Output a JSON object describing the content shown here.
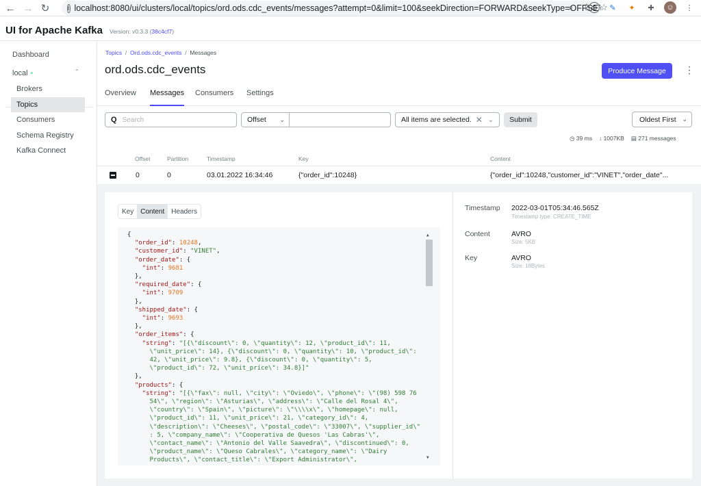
{
  "browser": {
    "url": "localhost:8080/ui/clusters/local/topics/ord.ods.cdc_events/messages?attempt=0&limit=100&seekDirection=FORWARD&seekType=OFFSET..."
  },
  "app": {
    "title": "UI for Apache Kafka",
    "version_prefix": "Version: v0.3.3 (",
    "version_hash": "38c4cf7",
    "version_suffix": ")"
  },
  "sidebar": {
    "dashboard": "Dashboard",
    "cluster": "local",
    "cluster_status_dot": "•",
    "items": [
      "Brokers",
      "Topics",
      "Consumers",
      "Schema Registry",
      "Kafka Connect"
    ]
  },
  "breadcrumb": {
    "topics": "Topics",
    "topic": "Ord.ods.cdc_events",
    "current": "Messages"
  },
  "topic": {
    "title": "ord.ods.cdc_events",
    "produce_label": "Produce Message"
  },
  "tabs": [
    "Overview",
    "Messages",
    "Consumers",
    "Settings"
  ],
  "filters": {
    "search_placeholder": "Search",
    "seek_type": "Offset",
    "partitions": "All items are selected.",
    "submit_label": "Submit",
    "sort": "Oldest First"
  },
  "stats": {
    "elapsed": "39 ms",
    "bytes": "1007KB",
    "messages": "271 messages"
  },
  "table": {
    "headers": [
      "Offset",
      "Partition",
      "Timestamp",
      "Key",
      "Content"
    ],
    "row": {
      "offset": "0",
      "partition": "0",
      "timestamp": "03.01.2022 16:34:46",
      "key": "{\"order_id\":10248}",
      "content": "{\"order_id\":10248,\"customer_id\":\"VINET\",\"order_date\"..."
    }
  },
  "detail": {
    "segments": [
      "Key",
      "Content",
      "Headers"
    ],
    "timestamp_label": "Timestamp",
    "timestamp_value": "2022-03-01T05:34:46.565Z",
    "timestamp_type": "Timestamp type: CREATE_TIME",
    "content_label": "Content",
    "content_format": "AVRO",
    "content_size": "Size: 5KB",
    "key_label": "Key",
    "key_format": "AVRO",
    "key_size": "Size: 18Bytes"
  }
}
